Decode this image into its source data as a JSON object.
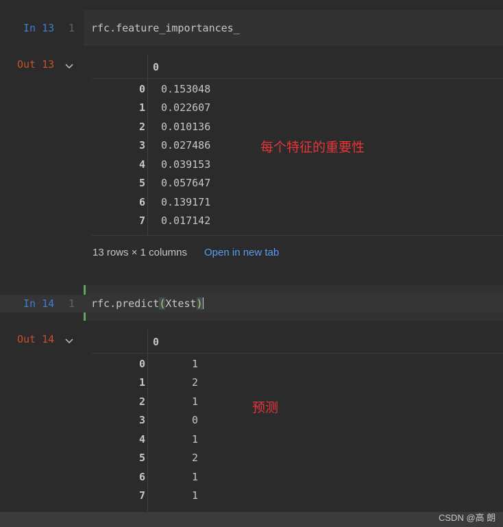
{
  "cells": [
    {
      "in_label": "In 13",
      "line_no": "1",
      "code": "rfc.feature_importances_",
      "out_label": "Out 13",
      "column_header": "0",
      "rows": [
        {
          "index": "0",
          "value": "0.153048"
        },
        {
          "index": "1",
          "value": "0.022607"
        },
        {
          "index": "2",
          "value": "0.010136"
        },
        {
          "index": "3",
          "value": "0.027486"
        },
        {
          "index": "4",
          "value": "0.039153"
        },
        {
          "index": "5",
          "value": "0.057647"
        },
        {
          "index": "6",
          "value": "0.139171"
        },
        {
          "index": "7",
          "value": "0.017142"
        }
      ],
      "summary": "13 rows × 1 columns",
      "open_link": "Open in new tab",
      "annotation": "每个特征的重要性"
    },
    {
      "in_label": "In 14",
      "line_no": "1",
      "code_prefix": "rfc.predict",
      "code_open": "(",
      "code_arg": "Xtest",
      "code_close": ")",
      "out_label": "Out 14",
      "column_header": "0",
      "rows": [
        {
          "index": "0",
          "value": "1"
        },
        {
          "index": "1",
          "value": "2"
        },
        {
          "index": "2",
          "value": "1"
        },
        {
          "index": "3",
          "value": "0"
        },
        {
          "index": "4",
          "value": "1"
        },
        {
          "index": "5",
          "value": "2"
        },
        {
          "index": "6",
          "value": "1"
        },
        {
          "index": "7",
          "value": "1"
        }
      ],
      "annotation": "预测"
    }
  ],
  "watermark": "CSDN @高 朗",
  "colors": {
    "background": "#2b2b2b",
    "in_label": "#3d7fd1",
    "out_label": "#c7512a",
    "link": "#589df6",
    "annotation": "#e8353a",
    "active_cell_bar": "#5fa85f"
  }
}
